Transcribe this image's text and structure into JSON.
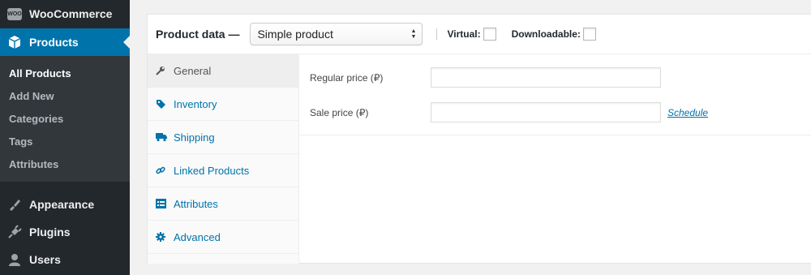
{
  "sidebar": {
    "woocommerce": {
      "label": "WooCommerce",
      "badge": "WOO"
    },
    "products": {
      "label": "Products"
    },
    "submenu": [
      {
        "label": "All Products",
        "current": true
      },
      {
        "label": "Add New"
      },
      {
        "label": "Categories"
      },
      {
        "label": "Tags"
      },
      {
        "label": "Attributes"
      }
    ],
    "appearance": {
      "label": "Appearance"
    },
    "plugins": {
      "label": "Plugins"
    },
    "users": {
      "label": "Users"
    }
  },
  "product_data": {
    "title": "Product data —",
    "type_select": {
      "value": "Simple product"
    },
    "virtual_label": "Virtual:",
    "downloadable_label": "Downloadable:",
    "tabs": [
      {
        "label": "General",
        "icon": "wrench-icon",
        "active": true
      },
      {
        "label": "Inventory",
        "icon": "tag-icon"
      },
      {
        "label": "Shipping",
        "icon": "truck-icon"
      },
      {
        "label": "Linked Products",
        "icon": "link-icon"
      },
      {
        "label": "Attributes",
        "icon": "list-icon"
      },
      {
        "label": "Advanced",
        "icon": "gear-icon"
      }
    ],
    "fields": {
      "regular_price": {
        "label": "Regular price (₽)",
        "value": ""
      },
      "sale_price": {
        "label": "Sale price (₽)",
        "value": ""
      },
      "schedule_link": "Schedule"
    }
  },
  "colors": {
    "sidebar_bg": "#23282d",
    "submenu_bg": "#32373c",
    "accent": "#0073aa"
  }
}
